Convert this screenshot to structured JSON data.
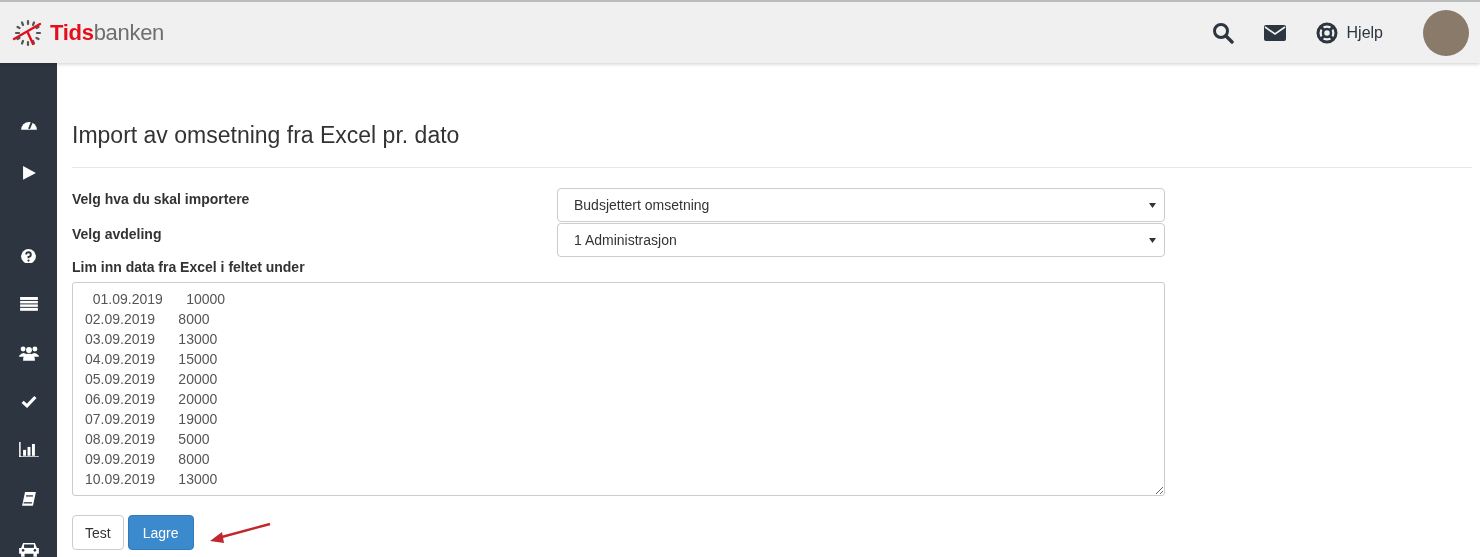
{
  "header": {
    "logo": {
      "accent": "Tids",
      "rest": "banken"
    },
    "help_label": "Hjelp"
  },
  "page": {
    "title": "Import av omsetning fra Excel pr. dato"
  },
  "form": {
    "fields": [
      {
        "kind": "select",
        "label": "Velg hva du skal importere",
        "value": "Budsjettert omsetning"
      },
      {
        "kind": "select",
        "label": "Velg avdeling",
        "value": "1 Administrasjon"
      },
      {
        "kind": "textarea",
        "label": "Lim inn data fra Excel i feltet under",
        "value": "  01.09.2019\t  10000\n02.09.2019\t8000\n03.09.2019\t13000\n04.09.2019\t15000\n05.09.2019\t20000\n06.09.2019\t20000\n07.09.2019\t19000\n08.09.2019\t5000\n09.09.2019\t8000\n10.09.2019\t13000"
      }
    ]
  },
  "buttons": [
    {
      "label": "Test",
      "kind": "default"
    },
    {
      "label": "Lagre",
      "kind": "primary"
    }
  ]
}
